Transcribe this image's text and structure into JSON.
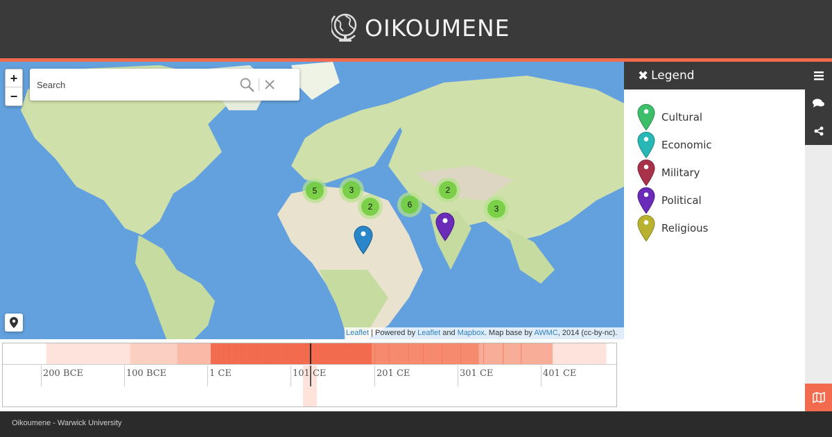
{
  "header": {
    "title": "OIKOUMENE",
    "logo_icon": "globe-icon"
  },
  "map": {
    "zoom_in_label": "+",
    "zoom_out_label": "−",
    "search_placeholder": "Search",
    "clusters": [
      {
        "count": "5"
      },
      {
        "count": "3"
      },
      {
        "count": "2"
      },
      {
        "count": "6"
      },
      {
        "count": "2"
      },
      {
        "count": "3"
      }
    ],
    "markers": [
      {
        "category": "Economic",
        "color": "#2b86c9"
      },
      {
        "category": "Political",
        "color": "#6a2bb8"
      }
    ],
    "attribution": {
      "leaflet1": "Leaflet",
      "sep": " | Powered by ",
      "leaflet2": "Leaflet",
      "and": " and ",
      "mapbox": "Mapbox",
      "base": ". Map base by ",
      "awmc": "AWMC",
      "tail": ", 2014 (cc-by-nc)."
    }
  },
  "legend": {
    "title": "Legend",
    "close_icon": "close-icon",
    "items": [
      {
        "label": "Cultural",
        "color": "#3dbf6a"
      },
      {
        "label": "Economic",
        "color": "#28b7b4"
      },
      {
        "label": "Military",
        "color": "#a8324a"
      },
      {
        "label": "Political",
        "color": "#6a2bb8"
      },
      {
        "label": "Religious",
        "color": "#b8b230"
      }
    ]
  },
  "rail": {
    "icons": [
      "menu-icon",
      "comments-icon",
      "share-icon"
    ],
    "map_icon": "map-icon"
  },
  "timeline": {
    "ticks": [
      "200 BCE",
      "100 BCE",
      "1 CE",
      "101 CE",
      "201 CE",
      "301 CE",
      "401 CE"
    ],
    "accent": "#f26b4e"
  },
  "footer": {
    "text": "Oikoumene - Warwick University"
  },
  "colors": {
    "accent": "#f26b4e",
    "dark": "#3a3a3a",
    "ocean": "#5f9fdf",
    "land": "#cfe0ab"
  }
}
